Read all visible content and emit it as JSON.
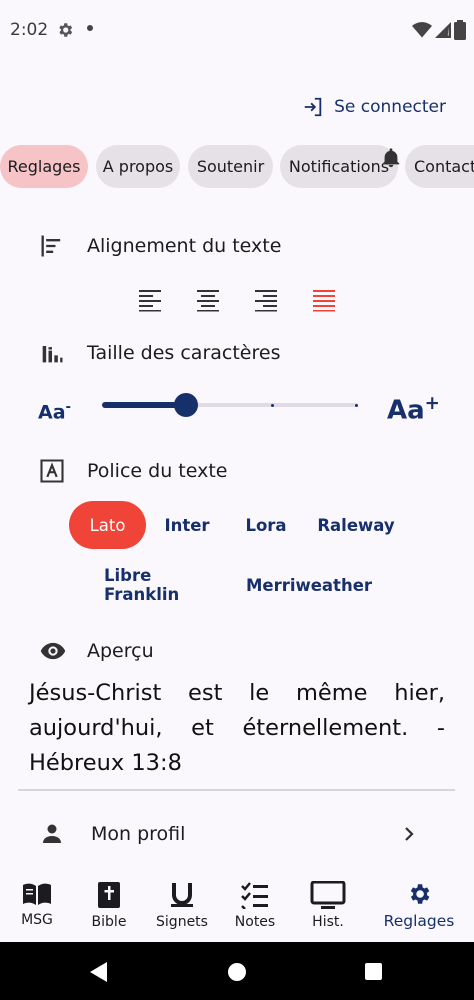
{
  "status": {
    "time": "2:02"
  },
  "header": {
    "login_label": "Se connecter"
  },
  "tabs": [
    {
      "label": "Reglages",
      "active": true
    },
    {
      "label": "A propos"
    },
    {
      "label": "Soutenir"
    },
    {
      "label": "Notifications"
    },
    {
      "label": "Contact"
    }
  ],
  "settings": {
    "alignment": {
      "title": "Alignement du texte",
      "options": [
        "left",
        "center",
        "right",
        "justify"
      ],
      "selected": "justify"
    },
    "font_size": {
      "title": "Taille des caractères",
      "small_label": "Aa-",
      "large_label": "Aa+",
      "level": 0.33
    },
    "font": {
      "title": "Police du texte",
      "options": [
        "Lato",
        "Inter",
        "Lora",
        "Raleway",
        "Libre Franklin",
        "Merriweather"
      ],
      "selected": "Lato"
    },
    "preview": {
      "title": "Aperçu",
      "text": "Jésus-Christ est le même hier, aujourd'hui, et éternellement. - Hébreux 13:8"
    },
    "profile": {
      "label": "Mon profil"
    }
  },
  "bottom_nav": [
    {
      "label": "MSG",
      "icon": "book-open-icon"
    },
    {
      "label": "Bible",
      "icon": "bible-icon"
    },
    {
      "label": "Signets",
      "icon": "bookmark-u-icon"
    },
    {
      "label": "Notes",
      "icon": "checklist-icon"
    },
    {
      "label": "Hist.",
      "icon": "monitor-icon"
    },
    {
      "label": "Reglages",
      "icon": "gear-icon",
      "active": true
    }
  ],
  "colors": {
    "accent": "#17306b",
    "selected_red": "#f04438",
    "active_chip": "#f6c3c6"
  }
}
